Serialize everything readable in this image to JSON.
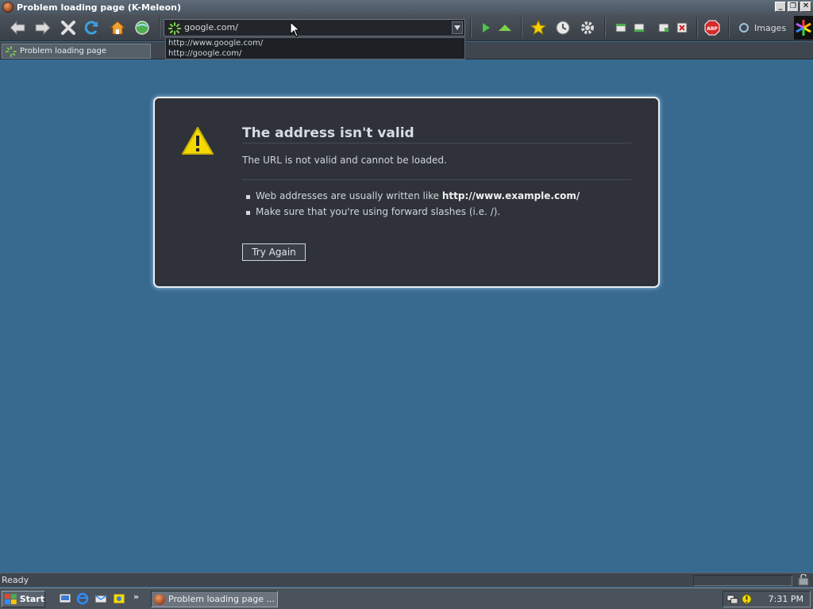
{
  "window": {
    "title": "Problem loading page (K-Meleon)",
    "minimize_label": "_",
    "maximize_label": "❐",
    "close_label": "✕"
  },
  "toolbar": {
    "buttons": [
      "back-icon",
      "forward-icon",
      "stop-icon",
      "reload-icon",
      "home-icon",
      "globe-icon",
      "go-icon",
      "up-icon",
      "bookmarks-icon",
      "history-icon",
      "settings-icon",
      "panel-icon",
      "panel-icon",
      "panel-icon",
      "close-tab-icon",
      "adblock-icon",
      "search-engine-icon",
      "k-meleon-throbber-icon"
    ],
    "adblock_label": "ABP",
    "search_label": "Images"
  },
  "urlbar": {
    "value": "google.com/",
    "suggestions": [
      "http://www.google.com/",
      "http://google.com/"
    ]
  },
  "tabs": [
    {
      "label": "Problem loading page",
      "active": true
    }
  ],
  "error": {
    "title": "The address isn't valid",
    "description": "The URL is not valid and cannot be loaded.",
    "bullets": [
      {
        "text": "Web addresses are usually written like ",
        "bold": "http://www.example.com/"
      },
      {
        "text": "Make sure that you're using forward slashes (i.e. /).",
        "bold": ""
      }
    ],
    "try_again_label": "Try Again"
  },
  "status": {
    "text": "Ready"
  },
  "taskbar": {
    "start_label": "Start",
    "quick_launch": [
      "show-desktop-icon",
      "internet-explorer-icon",
      "outlook-express-icon",
      "windows-media-icon"
    ],
    "chevron": "»",
    "tasks": [
      {
        "label": "Problem loading page ...",
        "active": true
      }
    ],
    "clock": "7:31 PM"
  },
  "colors": {
    "content_background": "#386a8f",
    "error_panel": "#2f3339",
    "toolbar": "#3f464e",
    "warning_yellow": "#f5d800"
  }
}
